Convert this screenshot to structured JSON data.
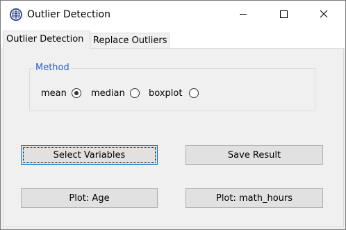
{
  "window": {
    "title": "Outlier Detection"
  },
  "tabs": [
    {
      "label": "Outlier Detection",
      "active": true
    },
    {
      "label": "Replace Outliers",
      "active": false
    }
  ],
  "method": {
    "legend": "Method",
    "legend_color": "#2c5dcd",
    "options": [
      {
        "label": "mean",
        "selected": true
      },
      {
        "label": "median",
        "selected": false
      },
      {
        "label": "boxplot",
        "selected": false
      }
    ]
  },
  "buttons": {
    "select_variables": "Select Variables",
    "save_result": "Save Result",
    "plot_age": "Plot: Age",
    "plot_math_hours": "Plot: math_hours"
  },
  "icons": {
    "app": "app-globe-icon",
    "minimize": "minimize-icon",
    "maximize": "maximize-icon",
    "close": "close-icon"
  }
}
